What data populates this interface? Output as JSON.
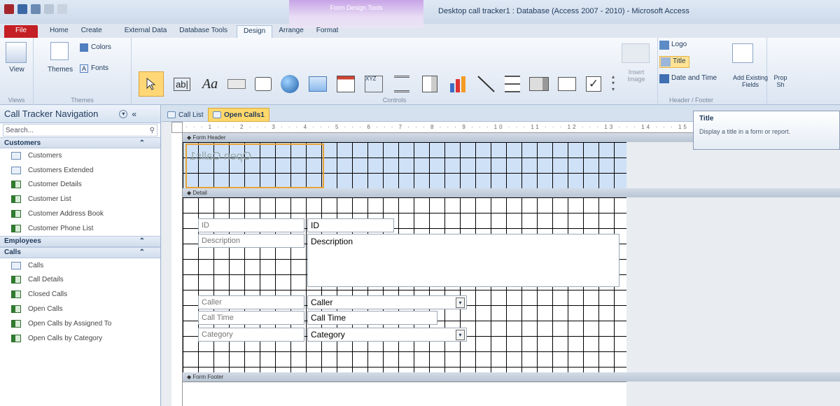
{
  "window": {
    "title": "Desktop call tracker1 : Database (Access 2007 - 2010) - Microsoft Access",
    "context_tab": "Form Design Tools"
  },
  "tabs": [
    "File",
    "Home",
    "Create",
    "External Data",
    "Database Tools",
    "Design",
    "Arrange",
    "Format"
  ],
  "ribbon": {
    "views_label": "Views",
    "view_btn": "View",
    "themes_label": "Themes",
    "themes_btn": "Themes",
    "colors_btn": "Colors",
    "fonts_btn": "Fonts",
    "controls_label": "Controls",
    "insert_image": "Insert Image",
    "logo": "Logo",
    "title": "Title",
    "date_time": "Date and Time",
    "header_footer_label": "Header / Footer",
    "add_fields": "Add Existing Fields",
    "property": "Prop Sh"
  },
  "nav": {
    "title": "Call Tracker Navigation",
    "search_placeholder": "Search...",
    "groups": [
      {
        "name": "Customers",
        "items": [
          "Customers",
          "Customers Extended",
          "Customer Details",
          "Customer List",
          "Customer Address Book",
          "Customer Phone List"
        ]
      },
      {
        "name": "Employees",
        "items": []
      },
      {
        "name": "Calls",
        "items": [
          "Calls",
          "Call Details",
          "Closed Calls",
          "Open Calls",
          "Open Calls by Assigned To",
          "Open Calls by Category"
        ]
      }
    ]
  },
  "doctabs": [
    "Call List",
    "Open Calls1"
  ],
  "ruler": "· · · 1 · · · 2 · · · 3 · · · 4 · · · 5 · · · 6 · · · 7 · · · 8 · · · 9 · · · 10 · · · 11 · · · 12 · · · 13 · · · 14 · · · 15 · · · 16 · · · 17 · · · 18",
  "sections": {
    "header": "Form Header",
    "detail": "Detail",
    "footer": "Form Footer"
  },
  "form": {
    "title": "Open Calls1",
    "fields": [
      {
        "label": "ID",
        "value": "ID"
      },
      {
        "label": "Description",
        "value": "Description"
      },
      {
        "label": "Caller",
        "value": "Caller"
      },
      {
        "label": "Call Time",
        "value": "Call Time"
      },
      {
        "label": "Category",
        "value": "Category"
      }
    ]
  },
  "tooltip": {
    "title": "Title",
    "text": "Display a title in a form or report."
  }
}
